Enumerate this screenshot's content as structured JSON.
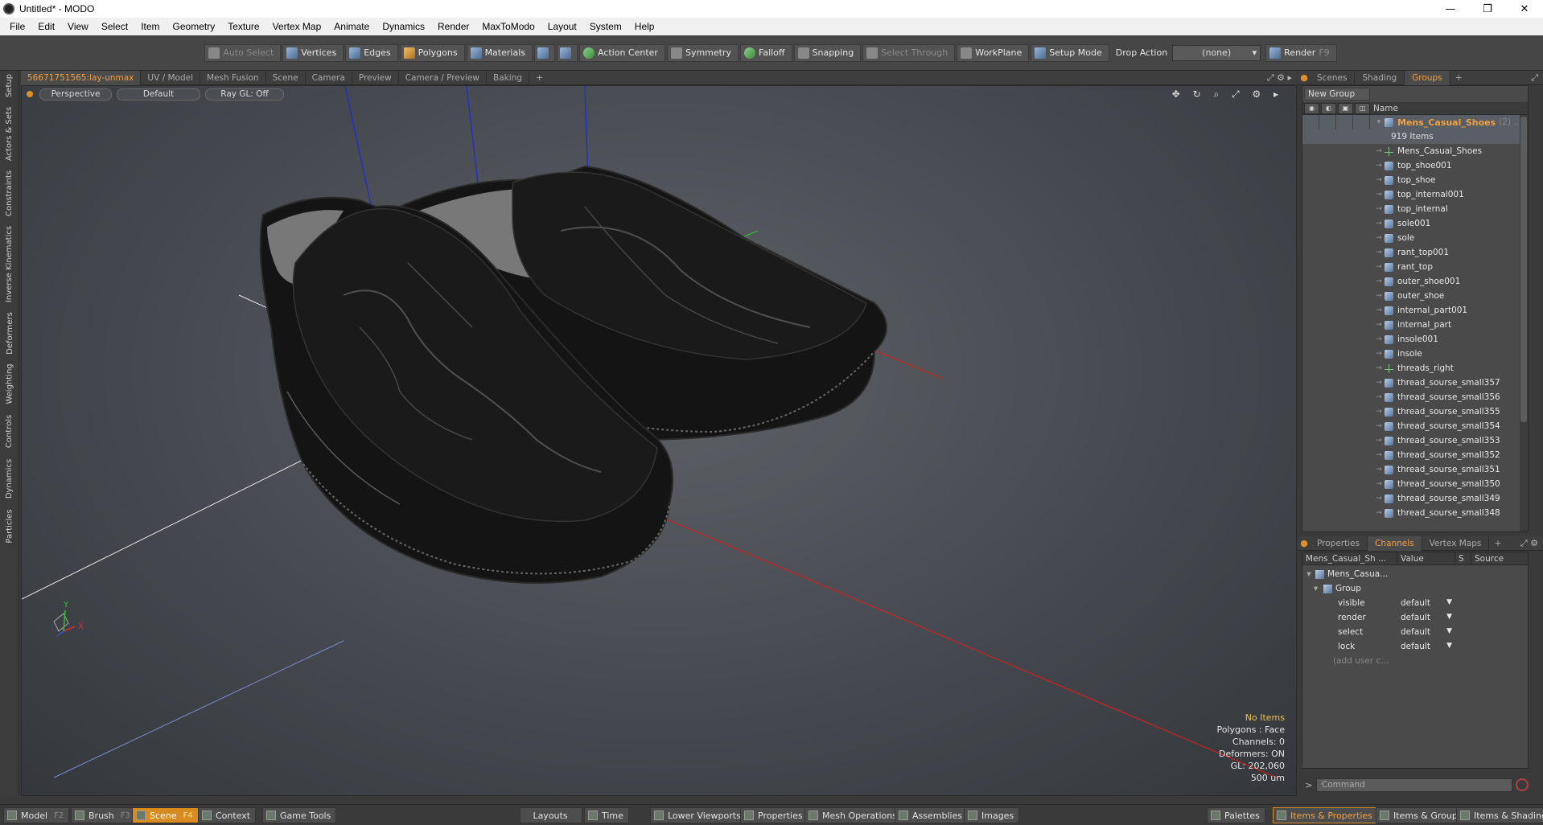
{
  "window": {
    "title": "Untitled* - MODO",
    "minimize": "—",
    "restore": "❐",
    "close": "✕"
  },
  "menu": [
    "File",
    "Edit",
    "View",
    "Select",
    "Item",
    "Geometry",
    "Texture",
    "Vertex Map",
    "Animate",
    "Dynamics",
    "Render",
    "MaxToModo",
    "Layout",
    "System",
    "Help"
  ],
  "toolbar": {
    "auto_select": "Auto Select",
    "vertices": "Vertices",
    "edges": "Edges",
    "polygons": "Polygons",
    "materials": "Materials",
    "action_center": "Action Center",
    "symmetry": "Symmetry",
    "falloff": "Falloff",
    "snapping": "Snapping",
    "select_through": "Select Through",
    "workplane": "WorkPlane",
    "setup_mode": "Setup Mode",
    "drop_action_label": "Drop Action",
    "drop_action_value": "(none)",
    "render": "Render",
    "render_key": "F9"
  },
  "left_tabs": [
    "Setup",
    "Actors & Sets",
    "Constraints",
    "Inverse Kinematics",
    "Deformers",
    "Weighting",
    "Controls",
    "Dynamics",
    "Particles"
  ],
  "viewport_tabs": [
    "56671751565:lay-unmax",
    "UV / Model",
    "Mesh Fusion",
    "Scene",
    "Camera",
    "Preview",
    "Camera / Preview",
    "Baking"
  ],
  "viewport_tab_add": "+",
  "viewport": {
    "view": "Perspective",
    "shading": "Default",
    "raygl": "Ray GL: Off",
    "tools": "✥ ↻ ⌕ ⤢ ⚙ ▸",
    "axis_x": "X",
    "axis_y": "Y",
    "info": {
      "items": "No Items",
      "polygons": "Polygons : Face",
      "channels": "Channels: 0",
      "deformers": "Deformers: ON",
      "gl": "GL: 202,060",
      "scale": "500 um"
    }
  },
  "right_tabs": [
    "Scenes",
    "Shading",
    "Groups"
  ],
  "right_tab_add": "+",
  "groups": {
    "new_group": "New Group",
    "name_header": "Name",
    "root_name": "Mens_Casual_Shoes",
    "root_count": "(2) ...",
    "items_count": "919 Items",
    "items": [
      {
        "name": "Mens_Casual_Shoes",
        "kind": "locator"
      },
      {
        "name": "top_shoe001",
        "kind": "mesh"
      },
      {
        "name": "top_shoe",
        "kind": "mesh"
      },
      {
        "name": "top_internal001",
        "kind": "mesh"
      },
      {
        "name": "top_internal",
        "kind": "mesh"
      },
      {
        "name": "sole001",
        "kind": "mesh"
      },
      {
        "name": "sole",
        "kind": "mesh"
      },
      {
        "name": "rant_top001",
        "kind": "mesh"
      },
      {
        "name": "rant_top",
        "kind": "mesh"
      },
      {
        "name": "outer_shoe001",
        "kind": "mesh"
      },
      {
        "name": "outer_shoe",
        "kind": "mesh"
      },
      {
        "name": "internal_part001",
        "kind": "mesh"
      },
      {
        "name": "internal_part",
        "kind": "mesh"
      },
      {
        "name": "insole001",
        "kind": "mesh"
      },
      {
        "name": "insole",
        "kind": "mesh"
      },
      {
        "name": "threads_right",
        "kind": "locator"
      },
      {
        "name": "thread_sourse_small357",
        "kind": "mesh"
      },
      {
        "name": "thread_sourse_small356",
        "kind": "mesh"
      },
      {
        "name": "thread_sourse_small355",
        "kind": "mesh"
      },
      {
        "name": "thread_sourse_small354",
        "kind": "mesh"
      },
      {
        "name": "thread_sourse_small353",
        "kind": "mesh"
      },
      {
        "name": "thread_sourse_small352",
        "kind": "mesh"
      },
      {
        "name": "thread_sourse_small351",
        "kind": "mesh"
      },
      {
        "name": "thread_sourse_small350",
        "kind": "mesh"
      },
      {
        "name": "thread_sourse_small349",
        "kind": "mesh"
      },
      {
        "name": "thread_sourse_small348",
        "kind": "mesh"
      }
    ]
  },
  "prop_tabs": [
    "Properties",
    "Channels",
    "Vertex Maps"
  ],
  "prop_tab_add": "+",
  "channels": {
    "col_name": "Mens_Casual_Sh ...",
    "col_value": "Value",
    "col_s": "S",
    "col_source": "Source",
    "root": "Mens_Casua...",
    "group": "Group",
    "rows": [
      {
        "name": "visible",
        "value": "default"
      },
      {
        "name": "render",
        "value": "default"
      },
      {
        "name": "select",
        "value": "default"
      },
      {
        "name": "lock",
        "value": "default"
      }
    ],
    "add_user": "(add user c..."
  },
  "command": {
    "placeholder": "Command",
    "arrow": ">"
  },
  "bottom": {
    "model": "Model",
    "model_key": "F2",
    "brush": "Brush",
    "brush_key": "F3",
    "scene": "Scene",
    "scene_key": "F4",
    "context": "Context",
    "game_tools": "Game Tools",
    "layouts": "Layouts",
    "time": "Time",
    "lower_viewports": "Lower Viewports",
    "properties": "Properties",
    "mesh_operations": "Mesh Operations",
    "assemblies": "Assemblies",
    "images": "Images",
    "palettes": "Palettes",
    "items_properties": "Items & Properties",
    "items_groups": "Items & Groups",
    "items_shading": "Items & Shading"
  },
  "colors": {
    "accent": "#f0a040",
    "active_button": "#d88b20"
  }
}
